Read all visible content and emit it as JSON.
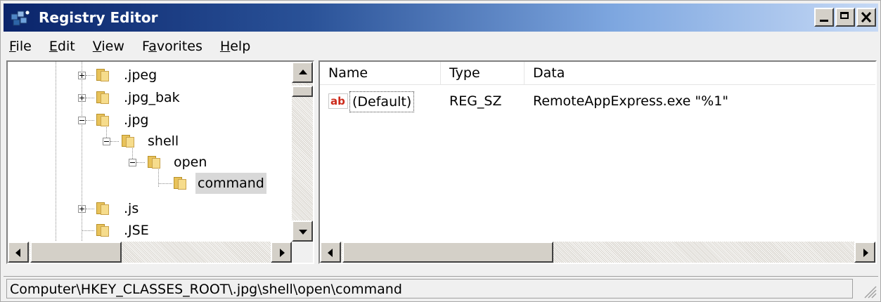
{
  "window": {
    "title": "Registry Editor"
  },
  "menu": {
    "items": [
      {
        "accel": "F",
        "rest": "ile"
      },
      {
        "accel": "E",
        "rest": "dit"
      },
      {
        "accel": "V",
        "rest": "iew"
      },
      {
        "pre": "F",
        "accel": "a",
        "rest": "vorites"
      },
      {
        "accel": "H",
        "rest": "elp"
      }
    ]
  },
  "tree": {
    "nodes": [
      {
        "label": ".jpeg",
        "state": "collapsed",
        "level": 0
      },
      {
        "label": ".jpg_bak",
        "state": "collapsed",
        "level": 0
      },
      {
        "label": ".jpg",
        "state": "expanded",
        "level": 0
      },
      {
        "label": "shell",
        "state": "expanded",
        "level": 1
      },
      {
        "label": "open",
        "state": "expanded",
        "level": 2
      },
      {
        "label": "command",
        "state": "leaf",
        "level": 3,
        "selected": true
      },
      {
        "label": ".js",
        "state": "collapsed",
        "level": 0
      },
      {
        "label": ".JSE",
        "state": "leaf",
        "level": 0
      }
    ]
  },
  "list": {
    "columns": {
      "name": "Name",
      "type": "Type",
      "data": "Data"
    },
    "rows": [
      {
        "icon": "string-value-icon",
        "icon_text": "ab",
        "name": "(Default)",
        "type": "REG_SZ",
        "data": "RemoteAppExpress.exe \"%1\""
      }
    ]
  },
  "status": {
    "path": "Computer\\HKEY_CLASSES_ROOT\\.jpg\\shell\\open\\command"
  },
  "colors": {
    "folder": "#e8c25a",
    "selection": "#d8d8d8",
    "icon_red": "#cc2a1b"
  }
}
